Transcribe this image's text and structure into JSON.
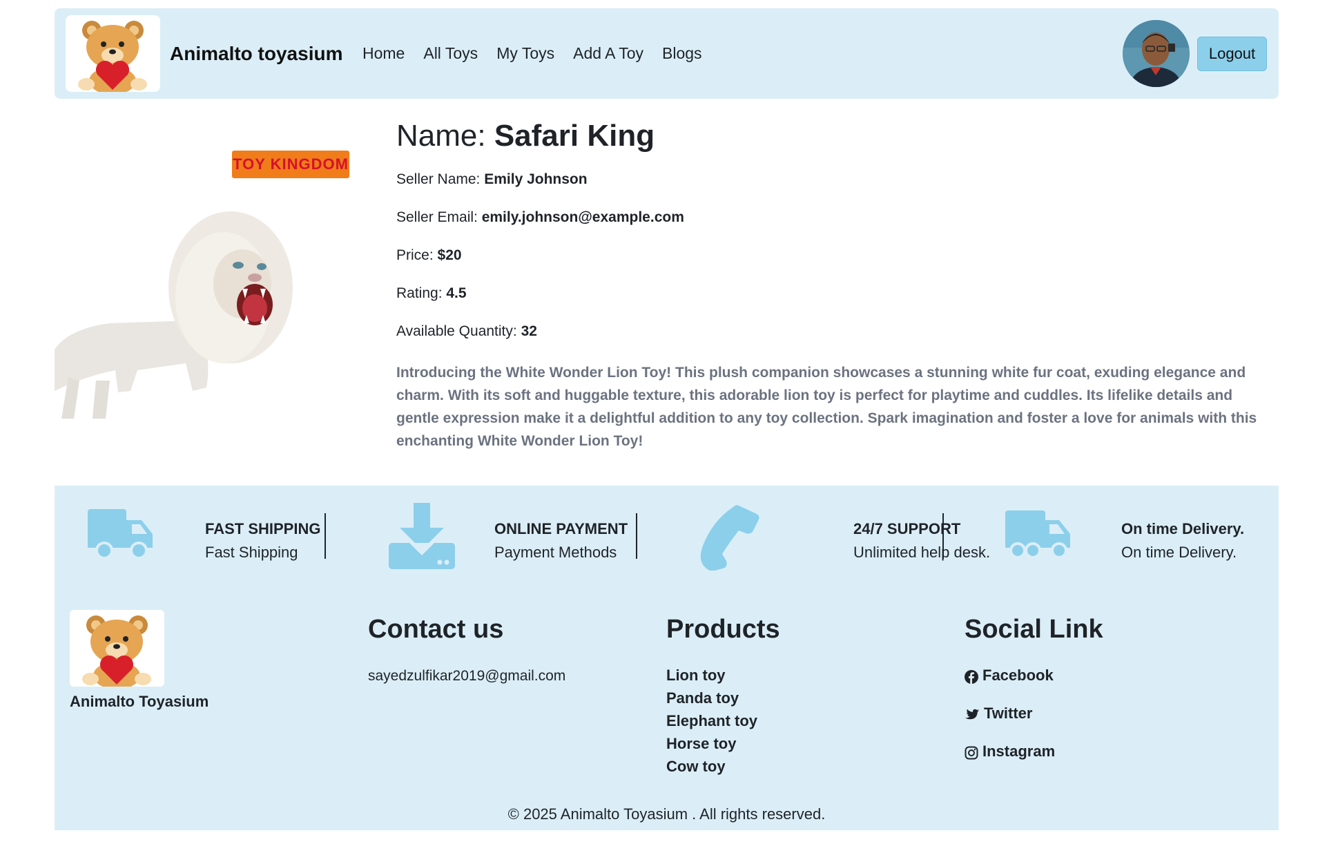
{
  "navbar": {
    "brand": "Animalto toyasium",
    "links": [
      "Home",
      "All Toys",
      "My Toys",
      "Add A Toy",
      "Blogs"
    ],
    "logout_label": "Logout"
  },
  "product": {
    "name_label": "Name: ",
    "name": "Safari King",
    "sticker_text": "TOY KINGDOM",
    "seller_name_label": "Seller Name: ",
    "seller_name": "Emily Johnson",
    "seller_email_label": "Seller Email: ",
    "seller_email": "emily.johnson@example.com",
    "price_label": "Price: ",
    "price": "$20",
    "rating_label": "Rating: ",
    "rating": "4.5",
    "quantity_label": "Available Quantity: ",
    "quantity": "32",
    "description": "Introducing the White Wonder Lion Toy! This plush companion showcases a stunning white fur coat, exuding elegance and charm. With its soft and huggable texture, this adorable lion toy is perfect for playtime and cuddles. Its lifelike details and gentle expression make it a delightful addition to any toy collection. Spark imagination and foster a love for animals with this enchanting White Wonder Lion Toy!"
  },
  "features": [
    {
      "title": "FAST SHIPPING",
      "subtitle": "Fast Shipping",
      "icon": "truck-icon"
    },
    {
      "title": "ONLINE PAYMENT",
      "subtitle": "Payment Methods",
      "icon": "download-icon"
    },
    {
      "title": "24/7 SUPPORT",
      "subtitle": "Unlimited help desk.",
      "icon": "phone-icon"
    },
    {
      "title": "On time Delivery.",
      "subtitle": "On time Delivery.",
      "icon": "delivery-truck-icon"
    }
  ],
  "footer": {
    "brand": "Animalto Toyasium",
    "contact_heading": "Contact us",
    "contact_email": "sayedzulfikar2019@gmail.com",
    "products_heading": "Products",
    "products": [
      "Lion toy",
      "Panda toy",
      "Elephant toy",
      "Horse toy",
      "Cow toy"
    ],
    "social_heading": "Social Link",
    "social": [
      "Facebook",
      "Twitter",
      "Instagram"
    ],
    "copyright": "© 2025 Animalto Toyasium . All rights reserved."
  },
  "colors": {
    "panel_bg": "#dbeef7",
    "accent": "#8ccfeb",
    "icon": "#8ccfeb"
  }
}
